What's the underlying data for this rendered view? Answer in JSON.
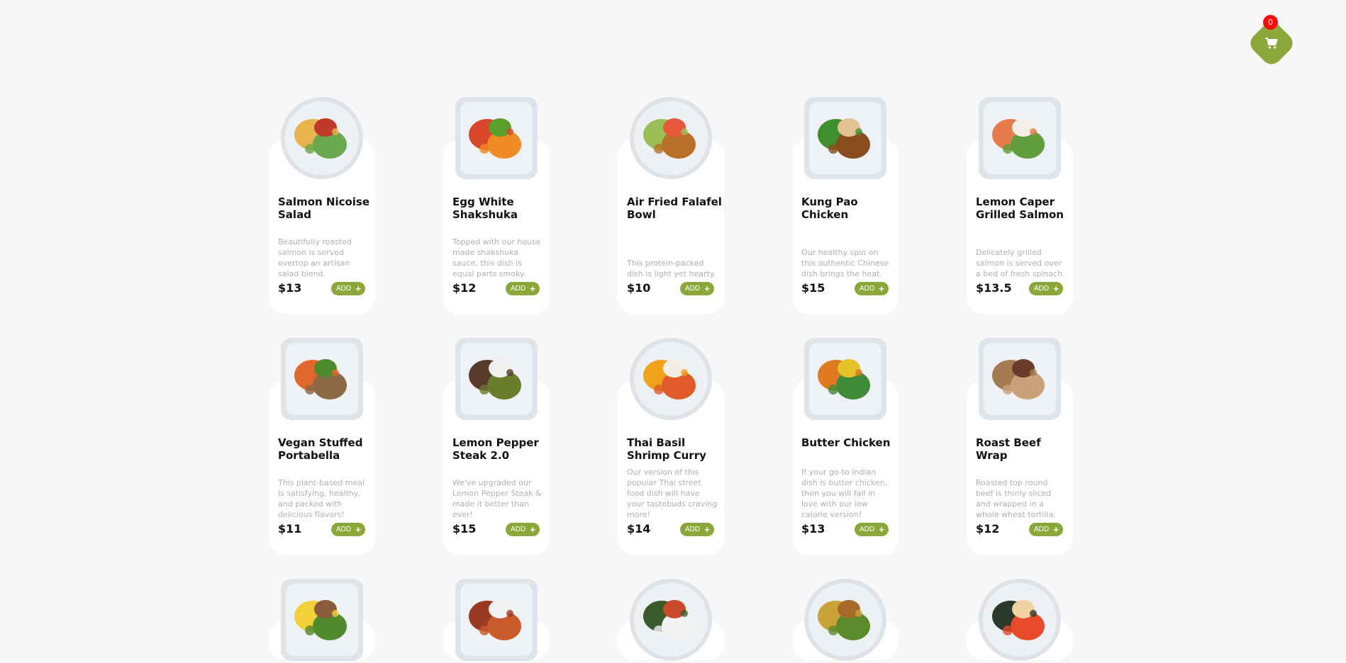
{
  "cart": {
    "count": "0",
    "icon": "cart-icon"
  },
  "colors": {
    "accent": "#8aa83a",
    "badge": "#ff0a0a"
  },
  "add_label": "ADD",
  "items": [
    {
      "name": "Salmon Nicoise Salad",
      "desc": "Beautifully roasted salmon is served overtop an artisan salad blend.",
      "price": "$13",
      "plate": "round"
    },
    {
      "name": "Egg White Shakshuka",
      "desc": "Topped with our house made shakshuka sauce, this dish is equal parts smoky.",
      "price": "$12",
      "plate": "square"
    },
    {
      "name": "Air Fried Falafel Bowl",
      "desc": "This protein-packed dish is light yet hearty.",
      "price": "$10",
      "plate": "round"
    },
    {
      "name": "Kung Pao Chicken",
      "desc": "Our healthy spin on this authentic Chinese dish brings the heat.",
      "price": "$15",
      "plate": "square"
    },
    {
      "name": "Lemon Caper Grilled Salmon",
      "desc": "Delicately grilled salmon is served over a bed of fresh spinach.",
      "price": "$13.5",
      "plate": "square"
    },
    {
      "name": "Vegan Stuffed Portabella",
      "desc": "This plant-based meal is satisfying, healthy, and packed with delicious flavors!",
      "price": "$11",
      "plate": "square"
    },
    {
      "name": "Lemon Pepper Steak 2.0",
      "desc": "We've upgraded our Lemon Pepper Steak & made it better than ever!",
      "price": "$15",
      "plate": "square"
    },
    {
      "name": "Thai Basil Shrimp Curry",
      "desc": "Our version of this popular Thai street food dish will have your tastebuds craving more!",
      "price": "$14",
      "plate": "round"
    },
    {
      "name": "Butter Chicken",
      "desc": "If your go-to Indian dish is butter chicken, then you will fall in love with our low calorie version!",
      "price": "$13",
      "plate": "square"
    },
    {
      "name": "Roast Beef Wrap",
      "desc": "Roasted top round beef is thinly sliced and wrapped in a whole wheat tortilla.",
      "price": "$12",
      "plate": "square"
    },
    {
      "name": "",
      "desc": "",
      "price": "",
      "plate": "square"
    },
    {
      "name": "",
      "desc": "",
      "price": "",
      "plate": "square"
    },
    {
      "name": "",
      "desc": "",
      "price": "",
      "plate": "round"
    },
    {
      "name": "",
      "desc": "",
      "price": "",
      "plate": "round"
    },
    {
      "name": "",
      "desc": "",
      "price": "",
      "plate": "round"
    }
  ]
}
